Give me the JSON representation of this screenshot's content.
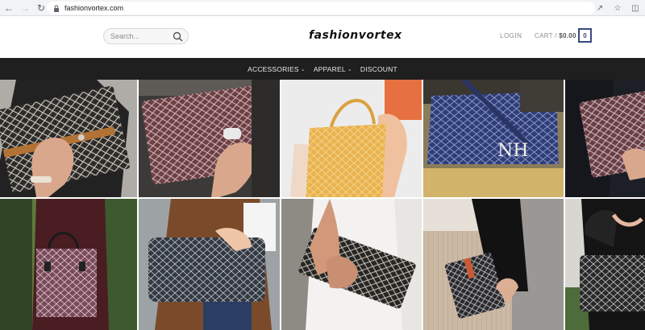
{
  "browser": {
    "url": "fashionvortex.com"
  },
  "header": {
    "search_placeholder": "Search...",
    "logo": "fashionvortex",
    "login": "LOGIN",
    "cart_label": "CART / ",
    "cart_total": "$0.00",
    "cart_count": "0"
  },
  "nav": {
    "items": [
      {
        "label": "ACCESSORIES",
        "has_dropdown": true
      },
      {
        "label": "APPAREL",
        "has_dropdown": true
      },
      {
        "label": "DISCOUNT",
        "has_dropdown": false
      }
    ]
  },
  "products": [
    {
      "name": "black-goyard-clutch"
    },
    {
      "name": "burgundy-goyard-pouch"
    },
    {
      "name": "yellow-goyard-tote"
    },
    {
      "name": "blue-goyard-tote-monogram"
    },
    {
      "name": "burgundy-goyard-clutch-cropped"
    },
    {
      "name": "burgundy-goyard-tote"
    },
    {
      "name": "black-goyard-tote"
    },
    {
      "name": "black-goyard-clutch-white-skirt"
    },
    {
      "name": "black-goyard-pouch-pleated-skirt"
    },
    {
      "name": "black-goyard-tote-leather-jacket"
    }
  ],
  "colors": {
    "navbar_bg": "#1f1f1f",
    "cart_accent": "#3a4a7e"
  }
}
